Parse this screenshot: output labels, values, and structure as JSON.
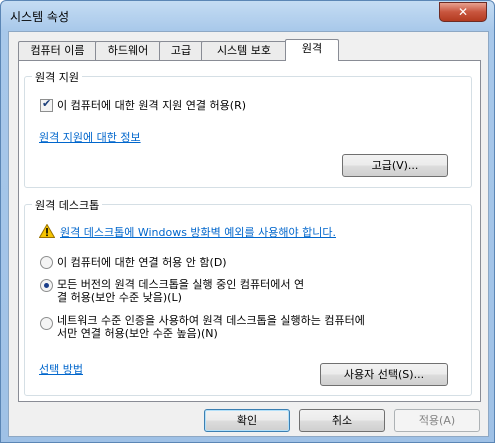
{
  "window": {
    "title": "시스템 속성",
    "close_glyph": "✕"
  },
  "tabs": [
    {
      "label": "컴퓨터 이름"
    },
    {
      "label": "하드웨어"
    },
    {
      "label": "고급"
    },
    {
      "label": "시스템 보호"
    },
    {
      "label": "원격"
    }
  ],
  "active_tab": "원격",
  "remote_assistance": {
    "title": "원격 지원",
    "allow_label": "이 컴퓨터에 대한 원격 지원 연결 허용(R)",
    "allow_checked": true,
    "info_link": "원격 지원에 대한 정보",
    "advanced_button": "고급(V)..."
  },
  "remote_desktop": {
    "title": "원격 데스크톱",
    "warning_link": "원격 데스크톱에 Windows 방화벽 예외를 사용해야 합니다.",
    "options": [
      {
        "label_lines": [
          "이 컴퓨터에 대한 연결 허용 안 함(D)"
        ],
        "selected": false
      },
      {
        "label_lines": [
          "모든 버전의 원격 데스크톱을 실행 중인 컴퓨터에서 연",
          "결 허용(보안 수준 낮음)(L)"
        ],
        "selected": true
      },
      {
        "label_lines": [
          "네트워크 수준 인증을 사용하여 원격 데스크톱을 실행하는 컴퓨터에",
          "서만 연결 허용(보안 수준 높음)(N)"
        ],
        "selected": false
      }
    ],
    "choose_link": "선택 방법",
    "select_users_button": "사용자 선택(S)..."
  },
  "footer": {
    "ok": "확인",
    "cancel": "취소",
    "apply": "적용(A)"
  },
  "colors": {
    "link": "#0066cc",
    "title_bar": "#a8c8ea",
    "close": "#c8553e",
    "warning": "#f5c400"
  }
}
